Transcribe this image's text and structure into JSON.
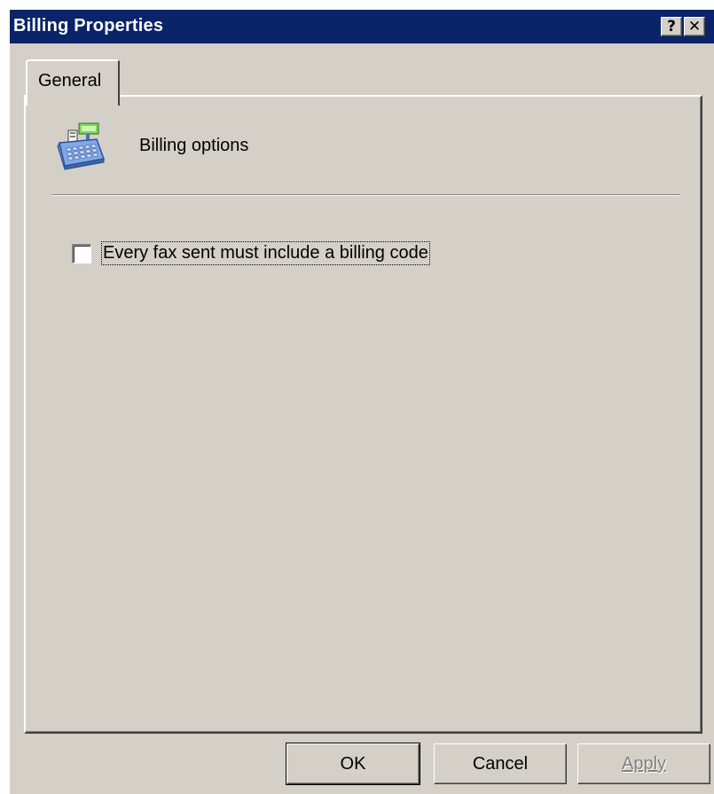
{
  "window": {
    "title": "Billing Properties",
    "help_glyph": "?",
    "close_glyph": "✕"
  },
  "tabs": [
    {
      "label": "General",
      "selected": true
    }
  ],
  "page": {
    "icon": "cash-register-icon",
    "heading": "Billing options"
  },
  "options": {
    "billing_code_required": {
      "label": "Every fax sent must include a billing code",
      "checked": false
    }
  },
  "buttons": {
    "ok": "OK",
    "cancel": "Cancel",
    "apply": "Apply",
    "apply_enabled": false
  },
  "colors": {
    "titlebar": "#0a246a",
    "face": "#d4d0c8",
    "disabled_text": "#808080"
  }
}
